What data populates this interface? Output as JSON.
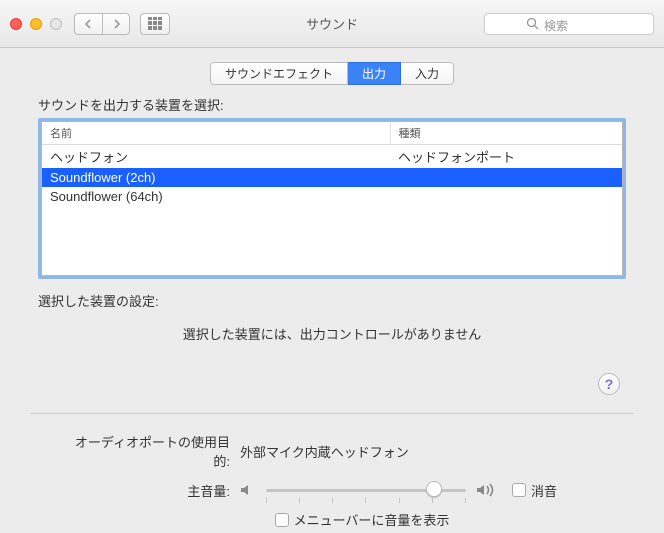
{
  "window": {
    "title": "サウンド",
    "search_placeholder": "検索"
  },
  "tabs": [
    {
      "label": "サウンドエフェクト",
      "active": false
    },
    {
      "label": "出力",
      "active": true
    },
    {
      "label": "入力",
      "active": false
    }
  ],
  "device_section": {
    "heading": "サウンドを出力する装置を選択:",
    "columns": {
      "name": "名前",
      "type": "種類"
    },
    "rows": [
      {
        "name": "ヘッドフォン",
        "type": "ヘッドフォンポート",
        "selected": false
      },
      {
        "name": "Soundflower (2ch)",
        "type": "",
        "selected": true
      },
      {
        "name": "Soundflower (64ch)",
        "type": "",
        "selected": false
      }
    ],
    "settings_label": "選択した装置の設定:",
    "no_controls": "選択した装置には、出力コントロールがありません"
  },
  "audio_port": {
    "label": "オーディオポートの使用目的:",
    "value": "外部マイク内蔵ヘッドフォン"
  },
  "volume": {
    "label": "主音量:",
    "value_percent": 80,
    "mute_label": "消音",
    "mute_checked": false,
    "menubar_label": "メニューバーに音量を表示",
    "menubar_checked": false
  },
  "icons": {
    "help": "?"
  }
}
